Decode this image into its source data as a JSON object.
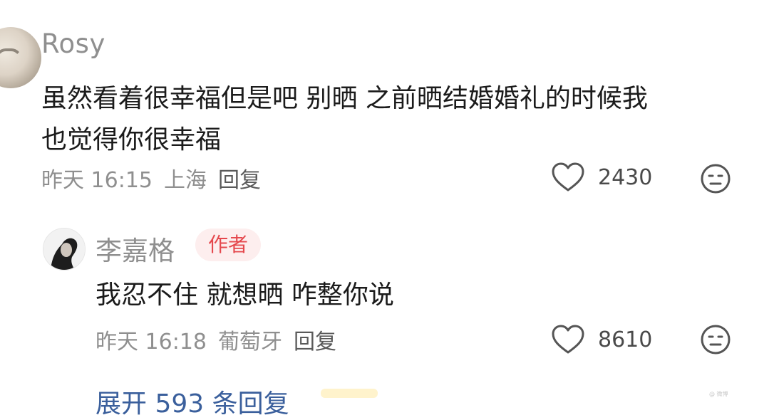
{
  "comment": {
    "username": "Rosy",
    "text_line1": "虽然看着很幸福但是吧 别晒 之前晒结婚婚礼的时候我",
    "text_line2": "也觉得你很幸福",
    "time": "昨天 16:15",
    "location": "上海",
    "reply_label": "回复",
    "likes": "2430",
    "avatar_icon": "user-avatar"
  },
  "reply": {
    "username": "李嘉格",
    "author_badge": "作者",
    "text": "我忍不住 就想晒 咋整你说",
    "time": "昨天 16:18",
    "location": "葡萄牙",
    "reply_label": "回复",
    "likes": "8610"
  },
  "expand": {
    "label": "展开 593 条回复"
  },
  "colors": {
    "badge_text": "#e5484d",
    "badge_bg": "#fdeeee",
    "link": "#3a5f9c",
    "meta": "#8f8f8f"
  },
  "icons": {
    "like": "heart-outline-icon",
    "dislike": "neutral-face-icon"
  },
  "watermark": "@ 微博"
}
